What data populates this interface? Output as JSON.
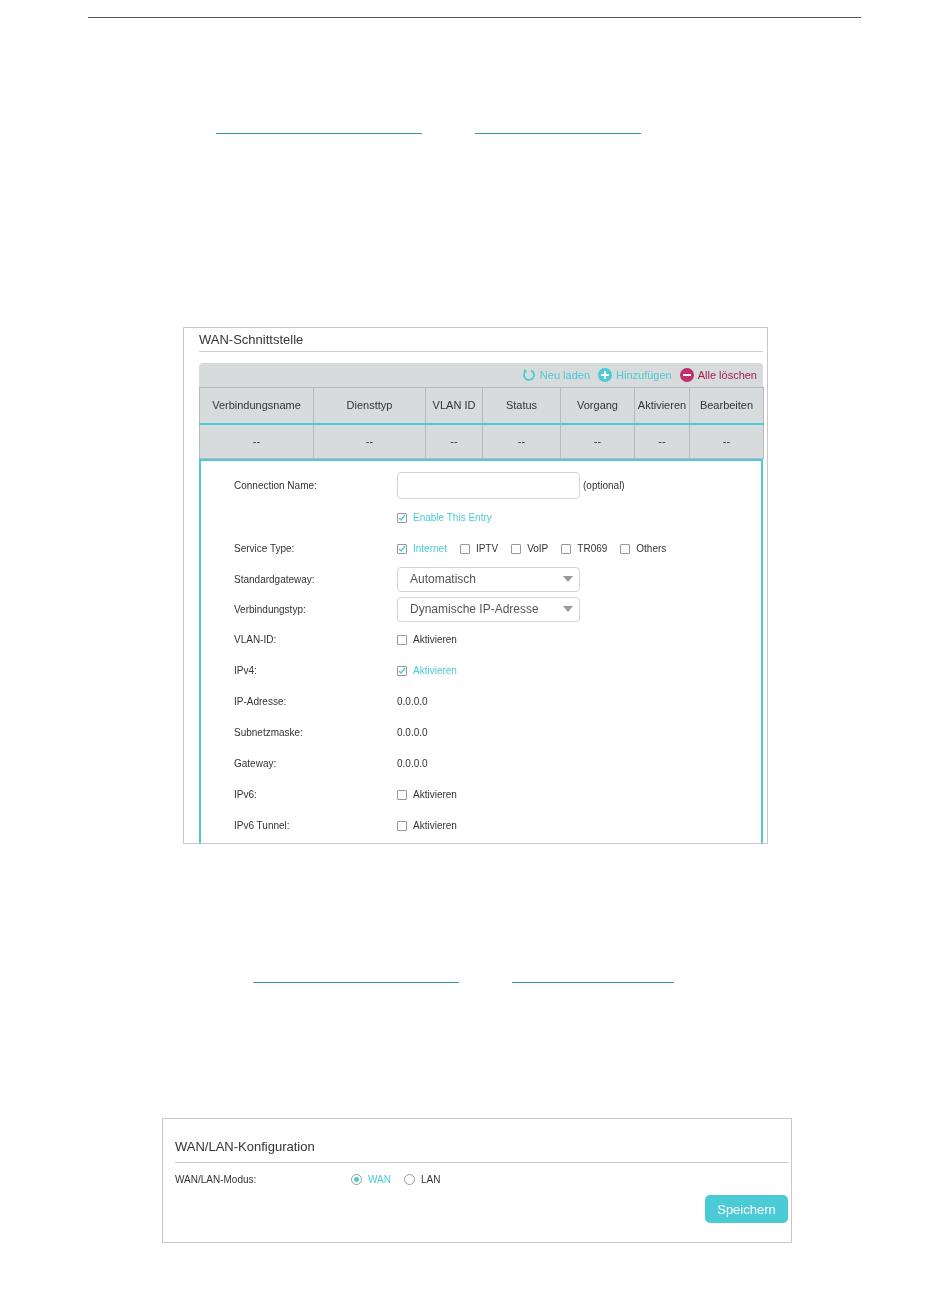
{
  "wan_panel": {
    "title": "WAN-Schnittstelle",
    "toolbar": [
      {
        "kind": "reload",
        "label": "Neu laden"
      },
      {
        "kind": "add",
        "label": "Hinzufügen"
      },
      {
        "kind": "delete",
        "label": "Alle löschen"
      }
    ],
    "table": {
      "columns": [
        "Verbindungsname",
        "Diensttyp",
        "VLAN ID",
        "Status",
        "Vorgang",
        "Aktivieren",
        "Bearbeiten"
      ],
      "rows": [
        [
          "--",
          "--",
          "--",
          "--",
          "--",
          "--",
          "--"
        ]
      ]
    },
    "form": [
      {
        "kind": "input",
        "label": "Connection Name:",
        "note": "(optional)"
      },
      {
        "kind": "checks",
        "options": [
          {
            "label": "Enable This Entry",
            "checked": true
          }
        ]
      },
      {
        "kind": "checks",
        "label": "Service Type:",
        "options": [
          {
            "label": "Internet",
            "checked": true
          },
          {
            "label": "IPTV",
            "checked": false
          },
          {
            "label": "VoIP",
            "checked": false
          },
          {
            "label": "TR069",
            "checked": false
          },
          {
            "label": "Others",
            "checked": false
          }
        ]
      },
      {
        "kind": "select",
        "label": "Standardgateway:",
        "value": "Automatisch"
      },
      {
        "kind": "select",
        "label": "Verbindungstyp:",
        "value": "Dynamische IP-Adresse"
      },
      {
        "kind": "checks",
        "label": "VLAN-ID:",
        "options": [
          {
            "label": "Aktivieren",
            "checked": false
          }
        ]
      },
      {
        "kind": "checks",
        "label": "IPv4:",
        "options": [
          {
            "label": "Aktivieren",
            "checked": true
          }
        ]
      },
      {
        "kind": "value",
        "label": "IP-Adresse:",
        "value": "0.0.0.0"
      },
      {
        "kind": "value",
        "label": "Subnetzmaske:",
        "value": "0.0.0.0"
      },
      {
        "kind": "value",
        "label": "Gateway:",
        "value": "0.0.0.0"
      },
      {
        "kind": "checks",
        "label": "IPv6:",
        "options": [
          {
            "label": "Aktivieren",
            "checked": false
          }
        ]
      },
      {
        "kind": "checks",
        "label": "IPv6 Tunnel:",
        "options": [
          {
            "label": "Aktivieren",
            "checked": false
          }
        ]
      }
    ]
  },
  "lan_panel": {
    "title": "WAN/LAN-Konfiguration",
    "mode": {
      "label": "WAN/LAN-Modus:",
      "options": [
        {
          "label": "WAN",
          "selected": true
        },
        {
          "label": "LAN",
          "selected": false
        }
      ]
    },
    "button": "Speichern"
  }
}
